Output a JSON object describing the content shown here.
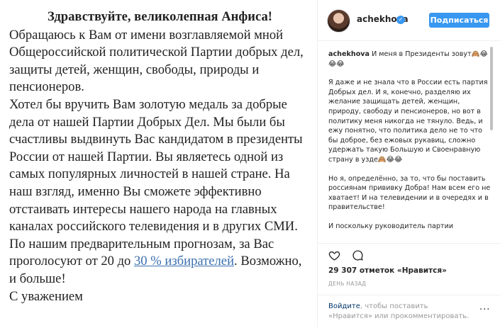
{
  "letter": {
    "greeting": "Здравствуйте, великолепная Анфиса!",
    "paragraph_1": "Обращаюсь к Вам от имени возглавляемой мной Общероссийской политической Партии добрых дел, защиты детей, женщин, свободы, природы и пенсионеров.",
    "paragraph_2_start": "Хотел бы вручить Вам золотую медаль за добрые дела от нашей Партии Добрых Дел. Мы были бы счастливы выдвинуть Вас кандидатом в президенты России от нашей Партии. Вы являетесь одной из самых популярных личностей в нашей стране. На наш взгляд, именно Вы сможете эффективно отстаивать интересы нашего народа на главных каналах российского телевидения  и в других СМИ. По нашим предварительным прогнозам, за Вас проголосуют от 20 до ",
    "paragraph_2_link": "30 % избирателей",
    "paragraph_2_end": ". Возможно, и больше!",
    "closing": "С уважением"
  },
  "header": {
    "username": "achekhova",
    "verified_mark": "✓",
    "follow_label": "Подписаться"
  },
  "caption": {
    "username": "achekhova",
    "p1": " И меня в Президенты зовут🙈😂😂😂",
    "p2": "Я даже и не знала что в России есть партия Добрых дел. И я, конечно, разделяю их желание защищать детей, женщин, природу, свободу и пенсионеров, но вот в политику меня никогда не тянуло. Ведь, и ежу понятно, что политика дело не то что бы доброе, без ежовых рукавиц, сложно удержать такую Большую и Своенравную страну в узде🙈😂😂",
    "p3": "Но я, определённо, за то, что бы поставить россиянам прививку Добра! Нам всем его не хватает! И на телевидении и в очередях и в правительстве!",
    "p4": "И поскольку руководитель партии"
  },
  "likes": {
    "text": "29 307 отметок «Нравится»"
  },
  "time": {
    "text": "ДЕНЬ НАЗАД"
  },
  "comment": {
    "login_link": "Войдите",
    "login_rest": ", чтобы поставить «Нравится» или прокомментировать.",
    "more": "···"
  },
  "icons": {
    "like": "heart-icon",
    "comment": "comment-icon",
    "more": "more-options-icon"
  },
  "colors": {
    "accent": "#3897f0",
    "link_in_letter": "#3a6fb0"
  }
}
